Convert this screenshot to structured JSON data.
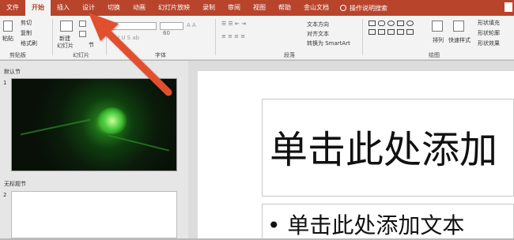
{
  "tabs": [
    "文件",
    "开始",
    "插入",
    "设计",
    "切换",
    "动画",
    "幻灯片放映",
    "录制",
    "审阅",
    "视图",
    "帮助",
    "金山文档"
  ],
  "tell_me": "操作说明搜索",
  "ribbon": {
    "clipboard": {
      "paste": "粘贴",
      "cut": "剪切",
      "copy": "复制",
      "format_painter": "格式刷",
      "label": "剪贴板"
    },
    "slides": {
      "new_slide": "新建",
      "new_slide_2": "幻灯片",
      "label": "幻灯片",
      "section": "节"
    },
    "font": {
      "size": "60",
      "label": "字体"
    },
    "paragraph": {
      "text_direction": "文本方向",
      "align_text": "对齐文本",
      "smartart": "转换为 SmartArt",
      "label": "段落"
    },
    "drawing": {
      "arrange": "排列",
      "quick_styles": "快速样式",
      "shape_fill": "形状填充",
      "shape_outline": "形状轮廓",
      "shape_effects": "形状效果",
      "label": "绘图"
    }
  },
  "panel": {
    "section1": "默认节",
    "section2": "无标题节",
    "slide1_num": "1",
    "slide2_num": "2"
  },
  "slide": {
    "title": "单击此处添加",
    "body": "• 单击此处添加文本"
  },
  "colors": {
    "accent": "#b8442c",
    "arrow": "#e2502f"
  }
}
